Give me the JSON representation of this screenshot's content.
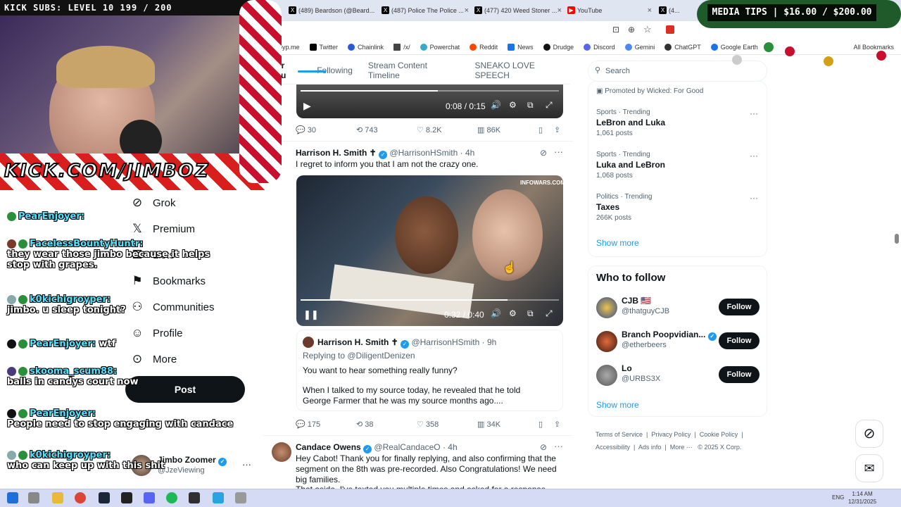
{
  "browser": {
    "tabs": [
      {
        "label": "(489) Beardson (@Beard..."
      },
      {
        "label": "(487) Police The Police ..."
      },
      {
        "label": "(477) 420 Weed Stoner ..."
      },
      {
        "label": "YouTube"
      },
      {
        "label": "(4..."
      }
    ],
    "bookmarks": [
      "Groyp.me",
      "Twitter",
      "Chainlink",
      "/x/",
      "Powerchat",
      "Reddit",
      "News",
      "Drudge",
      "Discord",
      "Gemini",
      "ChatGPT",
      "Google Earth"
    ],
    "all_bookmarks": "All Bookmarks"
  },
  "overlay": {
    "kick_subs": "KICK SUBS: LEVEL 10 199 / 200",
    "media_tips": "MEDIA TIPS | $16.00 / $200.00",
    "banner": "KICK.COM/JIMBOZ"
  },
  "chat": [
    {
      "user": "PearEnjoyer:",
      "msg": ""
    },
    {
      "user": "FacelessBountyHuntr:",
      "msg": "they wear those jimbo because it helps stop with grapes."
    },
    {
      "user": "k0kichigroyper:",
      "msg": "jimbo. u sleep tonight?"
    },
    {
      "user": "PearEnjoyer:",
      "msg": "wtf"
    },
    {
      "user": "skooma_scum88:",
      "msg": "balls in candys court now"
    },
    {
      "user": "PearEnjoyer:",
      "msg": "People need to stop engaging with candace"
    },
    {
      "user": "k0kichigroyper:",
      "msg": "who can keep up with this shit"
    }
  ],
  "nav": {
    "items": [
      "Grok",
      "Premium",
      "Lists",
      "Bookmarks",
      "Communities",
      "Profile",
      "More"
    ],
    "post": "Post",
    "profile_name": "Jimbo Zoomer",
    "profile_handle": "@JzeViewing"
  },
  "feed": {
    "tabs": [
      "For you",
      "Following",
      "Stream Content Timeline",
      "SNEAKO LOVE SPEECH"
    ],
    "video1": {
      "time": "0:08 / 0:15",
      "replies": "30",
      "reposts": "743",
      "likes": "8.2K",
      "views": "86K",
      "progress": 0.53
    },
    "tweet2": {
      "name": "Harrison H. Smith ✝",
      "handle": "@HarrisonHSmith",
      "age": "· 4h",
      "text": "I regret to inform you that I am not the crazy one.",
      "video_time": "0:32 / 0:40",
      "video_progress": 0.8,
      "quote_name": "Harrison H. Smith ✝",
      "quote_handle": "@HarrisonHSmith",
      "quote_age": "· 9h",
      "quote_reply": "Replying to @DiligentDenizen",
      "quote_text1": "You want to hear something really funny?",
      "quote_text2": "When I talked to my source today, he revealed that he told George Farmer that he was my source months ago....",
      "replies": "175",
      "reposts": "38",
      "likes": "358",
      "views": "34K"
    },
    "tweet3": {
      "name": "Candace Owens",
      "handle": "@RealCandaceO",
      "age": "· 4h",
      "text": "Hey Cabot! Thank you for finally replying, and also confirming that the segment on the 8th was pre-recorded. Also Congratulations! We need big families.",
      "text_cut": "That aside, I've texted you multiple times and asked for a response before I"
    }
  },
  "sidebar": {
    "search_placeholder": "Search",
    "promoted": "Promoted by Wicked: For Good",
    "trends": [
      {
        "cat": "Sports · Trending",
        "title": "LeBron and Luka",
        "count": "1,061 posts"
      },
      {
        "cat": "Sports · Trending",
        "title": "Luka and LeBron",
        "count": "1,068 posts"
      },
      {
        "cat": "Politics · Trending",
        "title": "Taxes",
        "count": "266K posts"
      }
    ],
    "show_more": "Show more",
    "who_title": "Who to follow",
    "who": [
      {
        "name": "CJB 🇺🇸",
        "handle": "@thatguyCJB"
      },
      {
        "name": "Branch Poopvidian...",
        "handle": "@etherbeers"
      },
      {
        "name": "Lo",
        "handle": "@URBS3X"
      }
    ],
    "follow": "Follow",
    "footer": [
      "Terms of Service",
      "Privacy Policy",
      "Cookie Policy",
      "Accessibility",
      "Ads info",
      "More ···",
      "© 2025 X Corp."
    ]
  },
  "taskbar": {
    "lang": "ENG",
    "time": "1:14 AM",
    "date": "12/31/2025"
  },
  "colors": {
    "accent": "#1d9bf0",
    "chat_user": "#52e3ff"
  }
}
